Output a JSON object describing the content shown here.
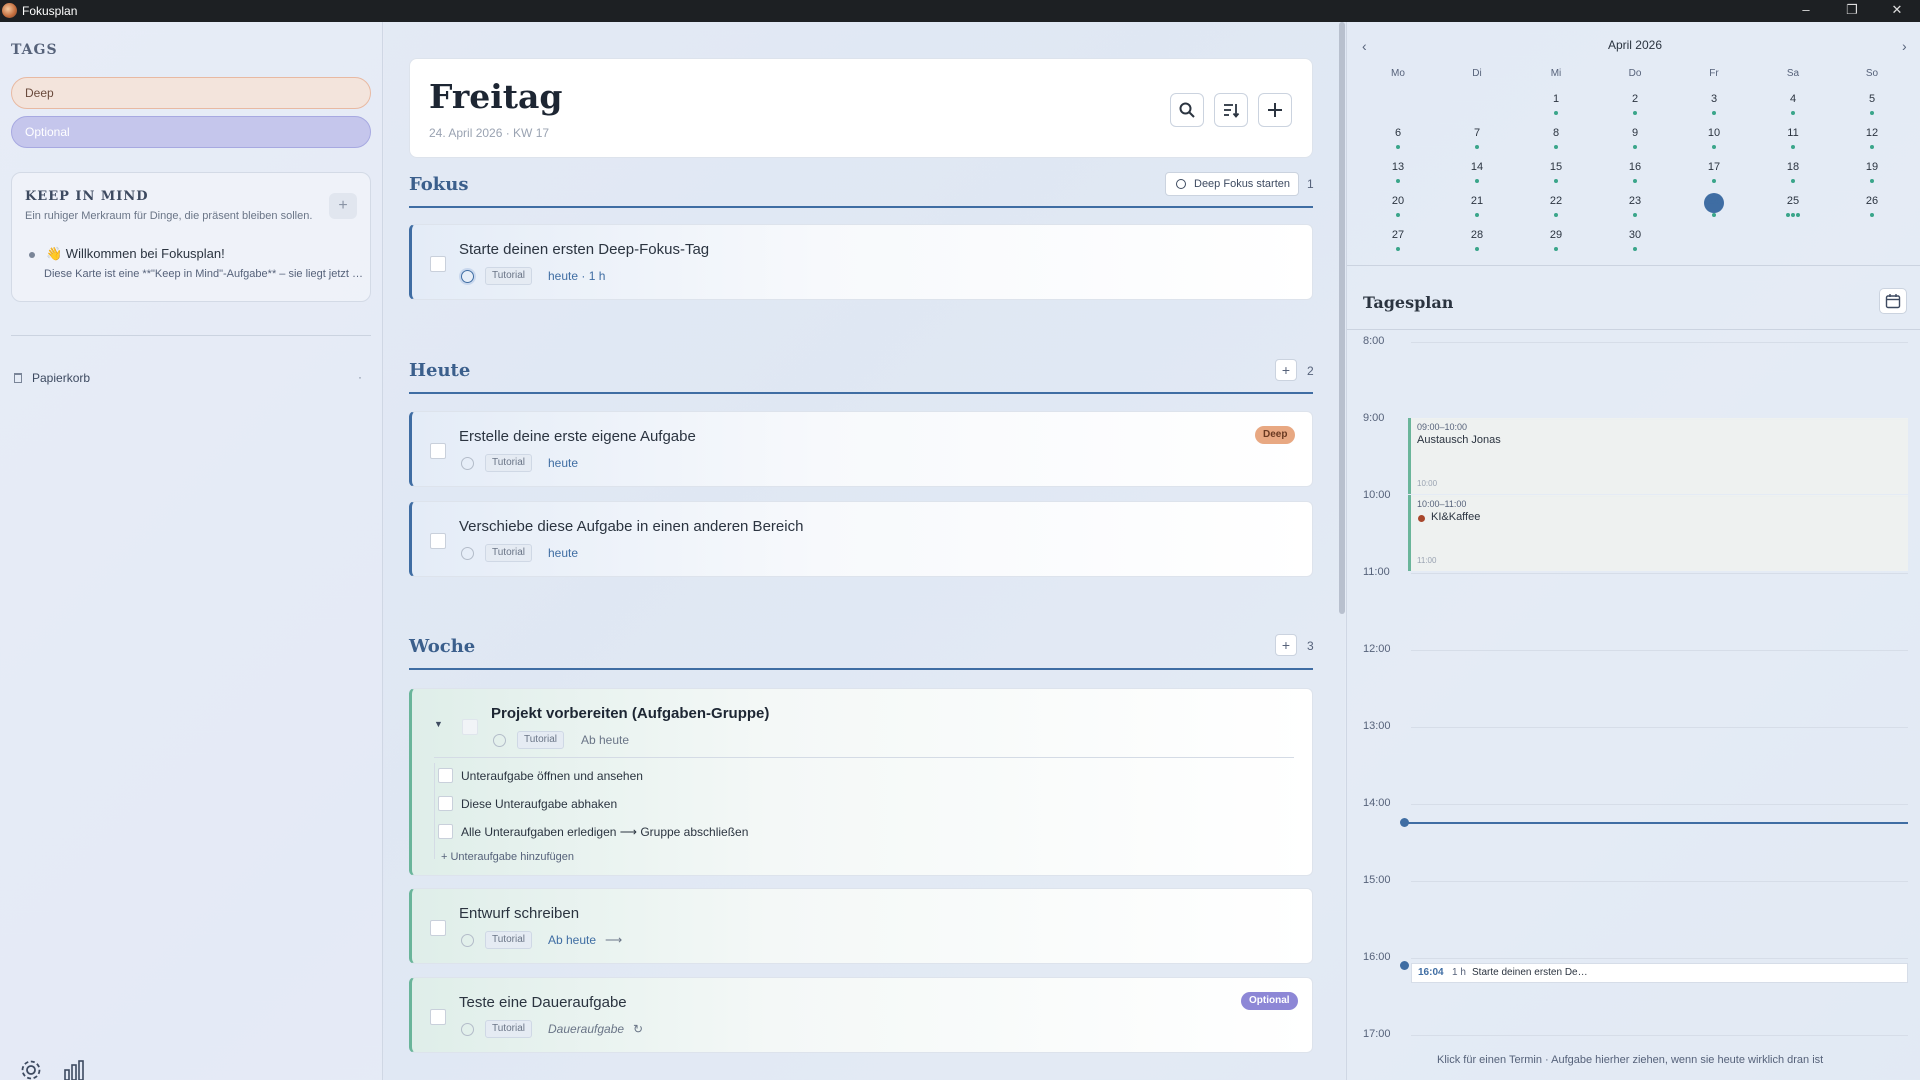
{
  "window": {
    "title": "Fokusplan",
    "minimize": "–",
    "maximize": "❐",
    "close": "✕"
  },
  "sidebar": {
    "tags_heading": "TAGS",
    "tags": [
      {
        "label": "Deep"
      },
      {
        "label": "Optional"
      }
    ],
    "keep_in_mind": {
      "title": "KEEP IN MIND",
      "subtitle": "Ein ruhiger Merkraum für Dinge, die präsent bleiben sollen.",
      "add": "+",
      "item_title": "👋 Willkommen bei Fokusplan!",
      "item_desc": "Diese Karte ist eine **\"Keep in Mind\"-Aufgabe** – sie liegt jetzt …"
    },
    "trash_label": "Papierkorb",
    "trash_more": "·"
  },
  "header": {
    "day": "Freitag",
    "date": "24. April 2026 · KW 17"
  },
  "sections": {
    "fokus": {
      "title": "Fokus",
      "count": "1",
      "deep_button": "Deep Fokus starten"
    },
    "heute": {
      "title": "Heute",
      "count": "2",
      "add": "+"
    },
    "woche": {
      "title": "Woche",
      "count": "3",
      "add": "+"
    }
  },
  "tasks": {
    "f1": {
      "title": "Starte deinen ersten Deep-Fokus-Tag",
      "tag": "Tutorial",
      "meta": "heute · 1 h"
    },
    "h1": {
      "title": "Erstelle deine erste eigene Aufgabe",
      "tag": "Tutorial",
      "meta": "heute",
      "badge": "Deep"
    },
    "h2": {
      "title": "Verschiebe diese Aufgabe in einen anderen Bereich",
      "tag": "Tutorial",
      "meta": "heute"
    },
    "group": {
      "title": "Projekt vorbereiten (Aufgaben-Gruppe)",
      "tag": "Tutorial",
      "meta": "Ab heute",
      "subtasks": [
        "Unteraufgabe öffnen und ansehen",
        "Diese Unteraufgabe abhaken",
        "Alle Unteraufgaben erledigen ⟶ Gruppe abschließen"
      ],
      "add_sub": "+ Unteraufgabe hinzufügen"
    },
    "w2": {
      "title": "Entwurf schreiben",
      "tag": "Tutorial",
      "meta": "Ab heute",
      "arrow": "⟶"
    },
    "w3": {
      "title": "Teste eine Daueraufgabe",
      "tag": "Tutorial",
      "meta": "Daueraufgabe",
      "repeat": "↻",
      "badge": "Optional"
    }
  },
  "calendar": {
    "title": "April 2026",
    "prev": "‹",
    "next": "›",
    "weekdays": [
      "Mo",
      "Di",
      "Mi",
      "Do",
      "Fr",
      "Sa",
      "So"
    ],
    "weeks": [
      [
        "",
        "",
        "1",
        "2",
        "3",
        "4",
        "5"
      ],
      [
        "6",
        "7",
        "8",
        "9",
        "10",
        "11",
        "12"
      ],
      [
        "13",
        "14",
        "15",
        "16",
        "17",
        "18",
        "19"
      ],
      [
        "20",
        "21",
        "22",
        "23",
        "24",
        "25",
        "26"
      ],
      [
        "27",
        "28",
        "29",
        "30",
        "",
        "",
        ""
      ]
    ],
    "today": "24",
    "selected_color": "#3f6da3",
    "dot_color": "#3aa58a"
  },
  "dayplan": {
    "title": "Tagesplan",
    "hours": [
      "8:00",
      "9:00",
      "10:00",
      "11:00",
      "12:00",
      "13:00",
      "14:00",
      "15:00",
      "16:00",
      "17:00"
    ],
    "events": [
      {
        "time": "09:00–10:00",
        "name": "Austausch Jonas",
        "end": "10:00"
      },
      {
        "time": "10:00–11:00",
        "name": "KI&Kaffee",
        "end": "11:00"
      }
    ],
    "scheduled": {
      "time": "16:04",
      "duration": "1 h",
      "name": "Starte deinen ersten De…"
    },
    "hint": "Klick für einen Termin · Aufgabe hierher ziehen, wenn sie heute wirklich dran ist"
  },
  "colors": {
    "accent": "#3f6da3",
    "green": "#6ab59a",
    "deep_badge": "#e8a882",
    "optional_badge": "#8d87d6"
  }
}
